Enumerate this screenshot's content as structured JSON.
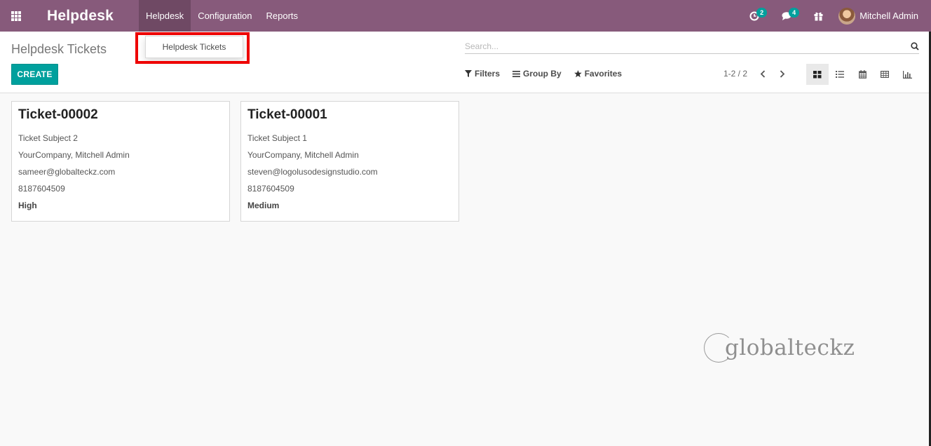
{
  "navbar": {
    "brand": "Helpdesk",
    "menu": [
      {
        "label": "Helpdesk"
      },
      {
        "label": "Configuration"
      },
      {
        "label": "Reports"
      }
    ],
    "activity_count": "2",
    "message_count": "4",
    "user_name": "Mitchell Admin"
  },
  "dropdown": {
    "item": "Helpdesk Tickets"
  },
  "control_panel": {
    "title": "Helpdesk Tickets",
    "create_label": "CREATE",
    "search_placeholder": "Search...",
    "filters_label": "Filters",
    "group_by_label": "Group By",
    "favorites_label": "Favorites",
    "pager": "1-2 / 2"
  },
  "tickets": [
    {
      "name": "Ticket-00002",
      "subject": "Ticket Subject 2",
      "customer": "YourCompany, Mitchell Admin",
      "email": "sameer@globalteckz.com",
      "phone": "8187604509",
      "priority": "High"
    },
    {
      "name": "Ticket-00001",
      "subject": "Ticket Subject 1",
      "customer": "YourCompany, Mitchell Admin",
      "email": "steven@logolusodesignstudio.com",
      "phone": "8187604509",
      "priority": "Medium"
    }
  ],
  "watermark": "globalteckz",
  "colors": {
    "navbar": "#875a7b",
    "accent": "#00a09d",
    "highlight": "#ee0000"
  }
}
